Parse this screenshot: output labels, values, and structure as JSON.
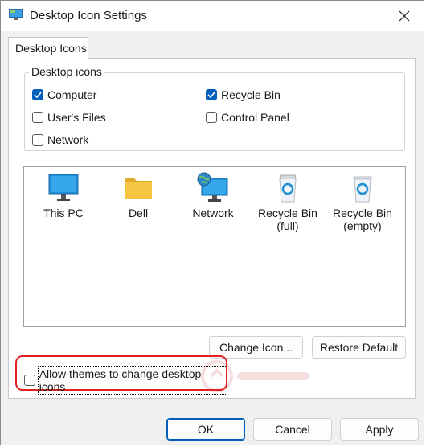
{
  "window": {
    "title": "Desktop Icon Settings"
  },
  "tabs": [
    {
      "label": "Desktop Icons"
    }
  ],
  "desktop_icons_group": {
    "legend": "Desktop icons",
    "options": [
      {
        "label": "Computer",
        "checked": true
      },
      {
        "label": "Recycle Bin",
        "checked": true
      },
      {
        "label": "User's Files",
        "checked": false
      },
      {
        "label": "Control Panel",
        "checked": false
      },
      {
        "label": "Network",
        "checked": false
      }
    ]
  },
  "icon_list": {
    "items": [
      {
        "label": "This PC",
        "icon": "monitor-icon"
      },
      {
        "label": "Dell",
        "icon": "folder-icon"
      },
      {
        "label": "Network",
        "icon": "network-icon"
      },
      {
        "label": "Recycle Bin\n(full)",
        "icon": "recycle-bin-full-icon"
      },
      {
        "label": "Recycle Bin\n(empty)",
        "icon": "recycle-bin-empty-icon"
      }
    ]
  },
  "buttons": {
    "change_icon": "Change Icon...",
    "restore_default": "Restore Default",
    "ok": "OK",
    "cancel": "Cancel",
    "apply": "Apply"
  },
  "allow_themes": {
    "label": "Allow themes to change desktop icons",
    "checked": false
  },
  "colors": {
    "accent": "#005fb8",
    "highlight_border": "#e02020",
    "monitor_blue": "#1f8fd6",
    "folder_yellow": "#f5c542"
  }
}
